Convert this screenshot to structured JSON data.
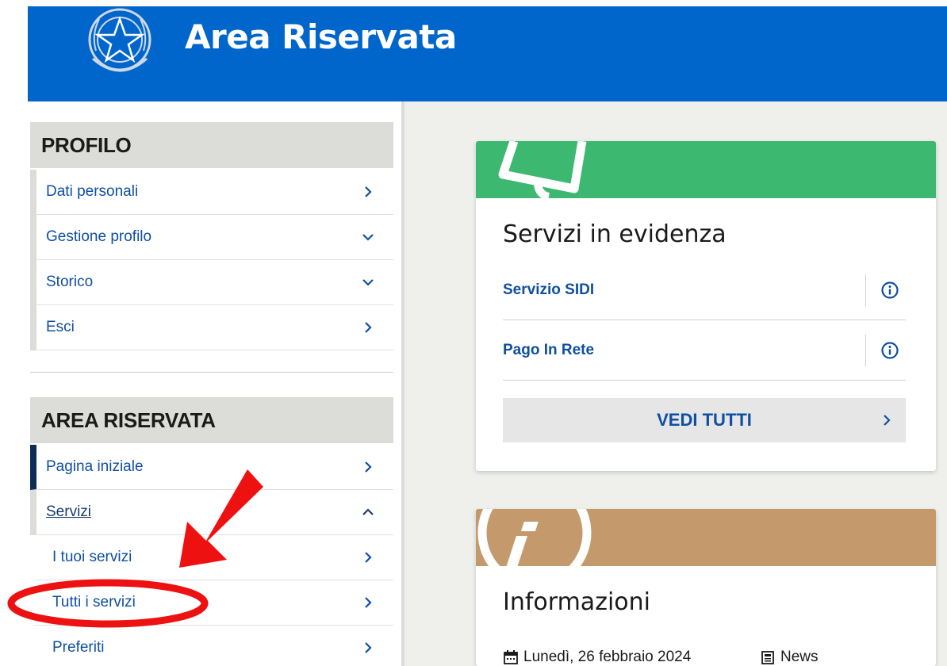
{
  "header": {
    "title": "Area Riservata"
  },
  "profile": {
    "title": "PROFILO",
    "items": [
      {
        "label": "Dati personali",
        "chevron": "right"
      },
      {
        "label": "Gestione profilo",
        "chevron": "down"
      },
      {
        "label": "Storico",
        "chevron": "down"
      },
      {
        "label": "Esci",
        "chevron": "right"
      }
    ]
  },
  "area": {
    "title": "AREA RISERVATA",
    "items": [
      {
        "label": "Pagina iniziale",
        "chevron": "right"
      },
      {
        "label": "Servizi",
        "chevron": "up"
      },
      {
        "label": "I tuoi servizi",
        "chevron": "right"
      },
      {
        "label": "Tutti i servizi",
        "chevron": "right"
      },
      {
        "label": "Preferiti",
        "chevron": "right"
      }
    ]
  },
  "servizi_card": {
    "title": "Servizi in evidenza",
    "banner_color": "#3db871",
    "services": [
      {
        "label": "Servizio SIDI"
      },
      {
        "label": "Pago In Rete"
      }
    ],
    "button": "VEDI TUTTI"
  },
  "info_card": {
    "title": "Informazioni",
    "banner_color": "#c49a6c",
    "date": "Lunedì, 26 febbraio 2024",
    "category": "News"
  },
  "colors": {
    "header": "#0066cc",
    "link": "#0f4fa1",
    "annotation": "#ee1111"
  }
}
